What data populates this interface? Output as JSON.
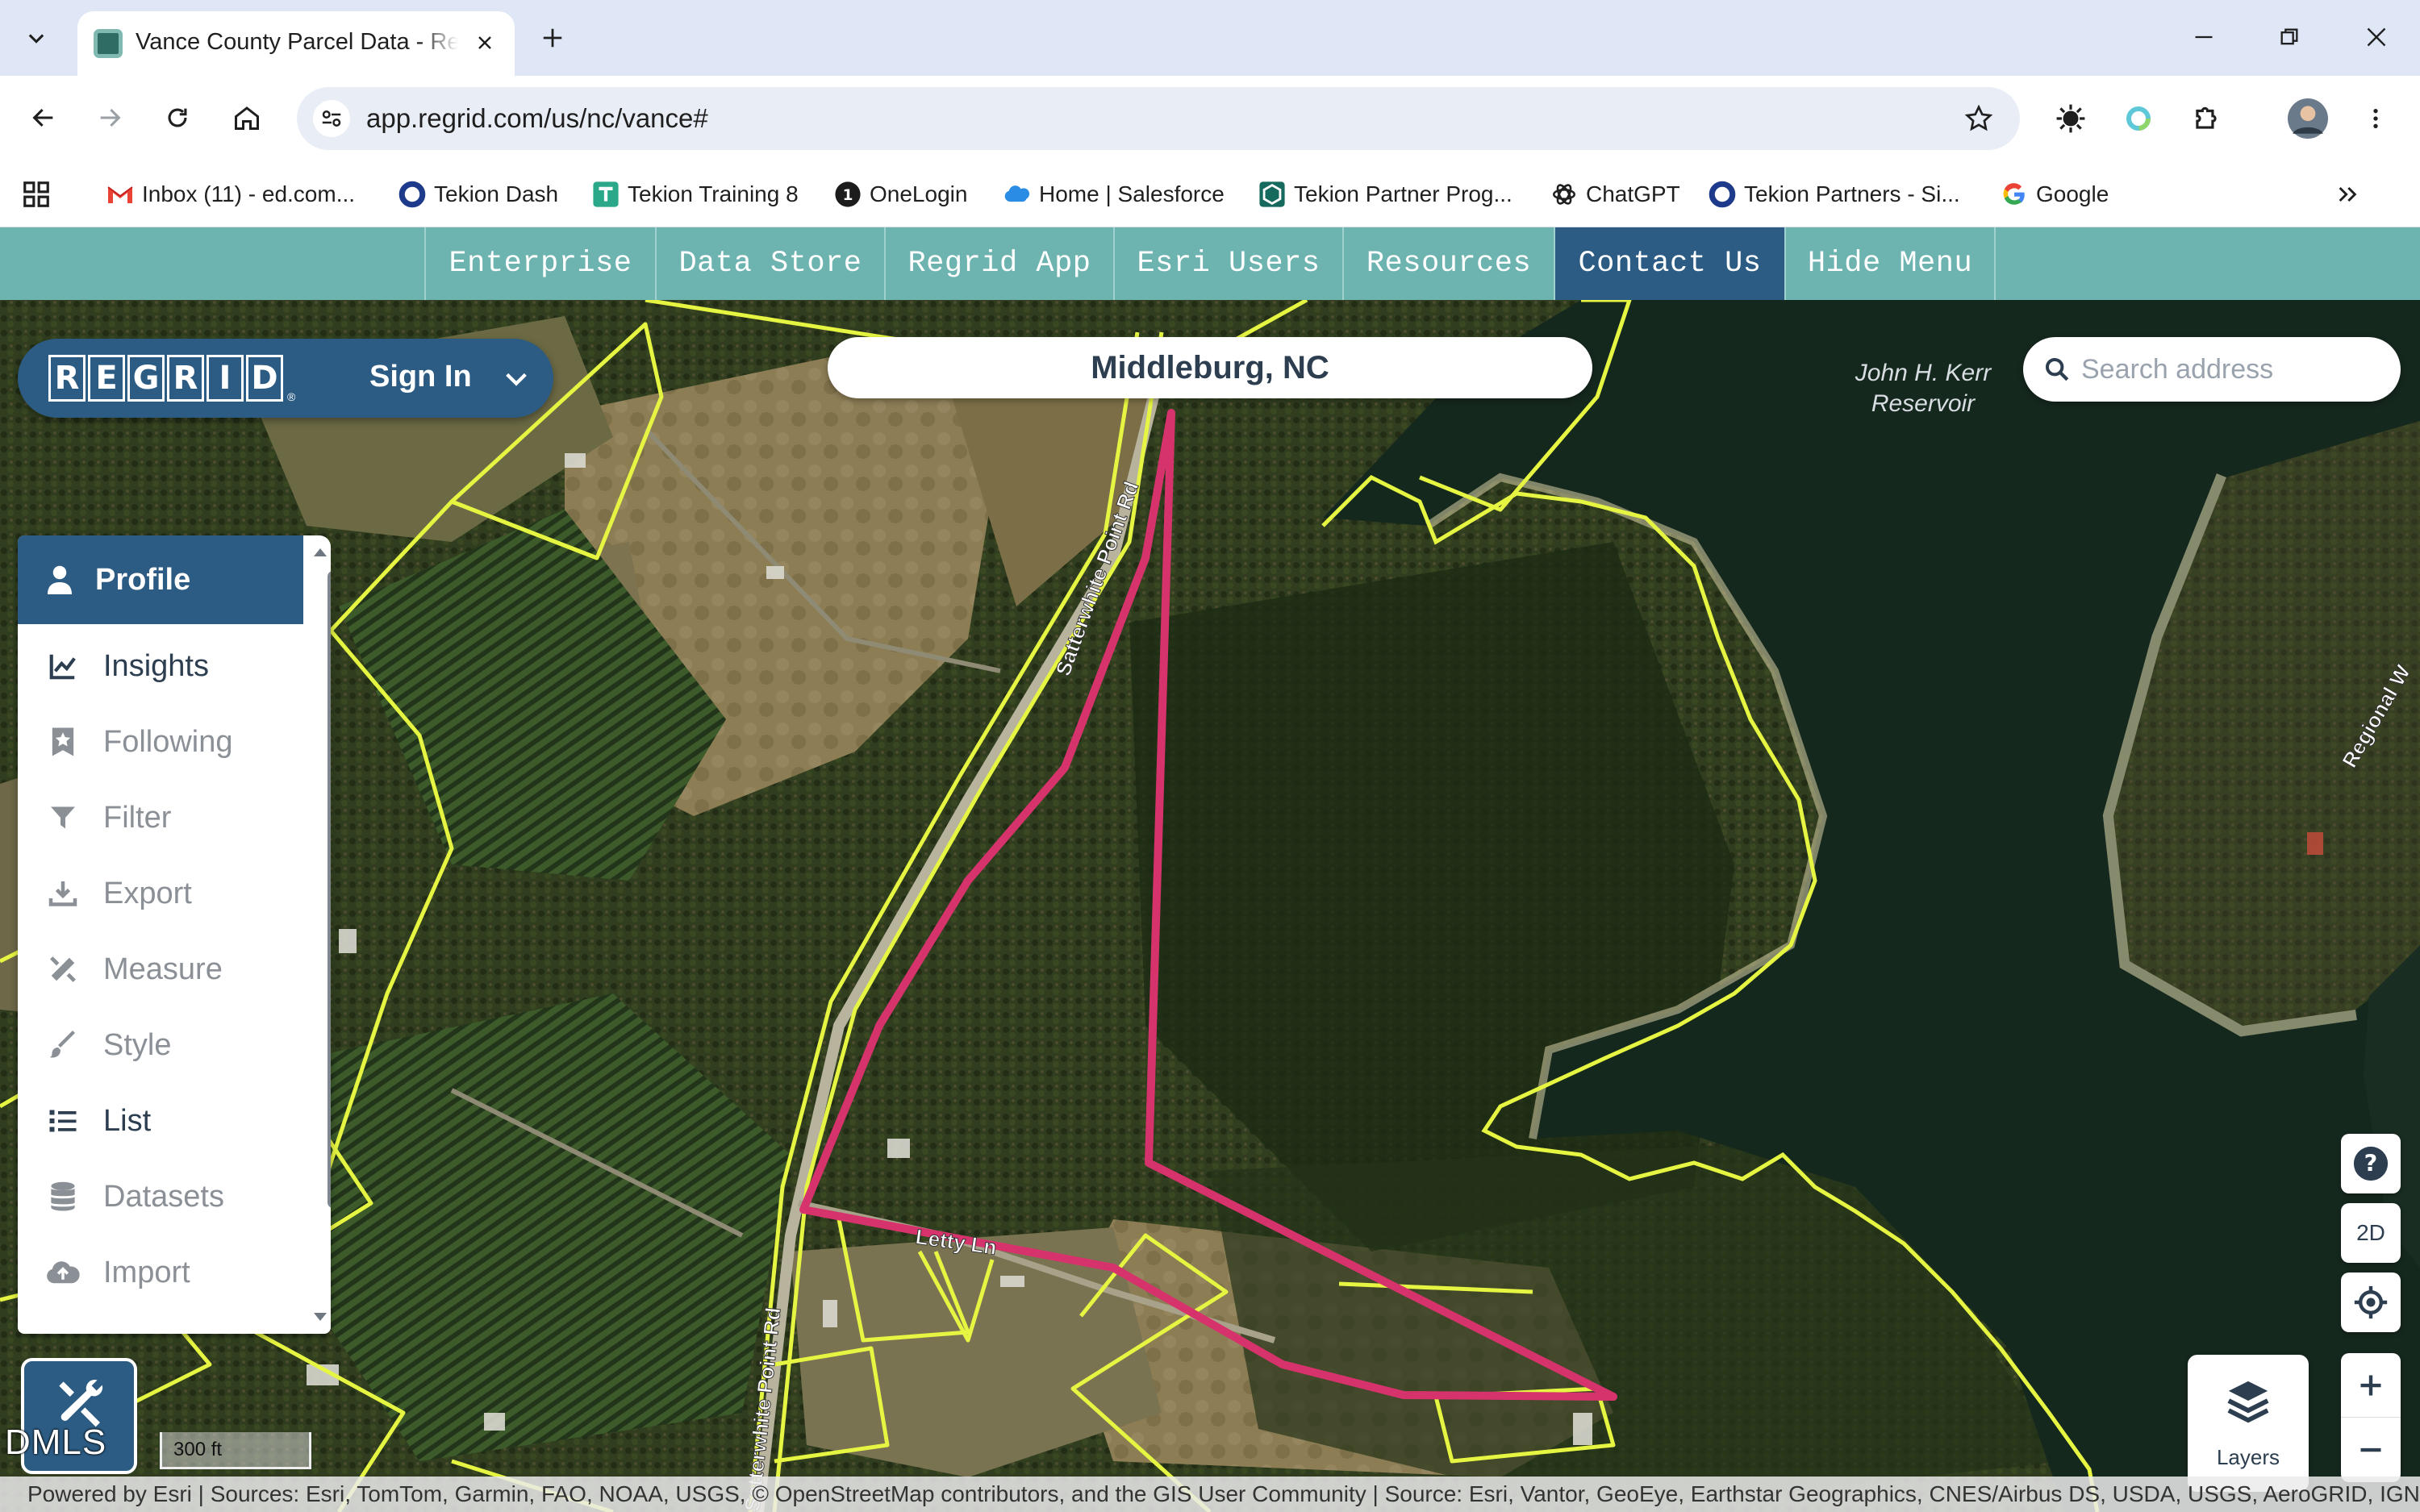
{
  "browser": {
    "tab_title": "Vance County Parcel Data - Regrid",
    "url": "app.regrid.com/us/nc/vance#",
    "bookmarks": [
      {
        "label": "Inbox (11) - ed.com..."
      },
      {
        "label": "Tekion Dash"
      },
      {
        "label": "Tekion Training 8"
      },
      {
        "label": "OneLogin"
      },
      {
        "label": "Home | Salesforce"
      },
      {
        "label": "Tekion Partner Prog..."
      },
      {
        "label": "ChatGPT"
      },
      {
        "label": "Tekion Partners - Si..."
      },
      {
        "label": "Google"
      }
    ]
  },
  "top_menu": {
    "items": [
      {
        "label": "Enterprise"
      },
      {
        "label": "Data Store"
      },
      {
        "label": "Regrid App"
      },
      {
        "label": "Esri Users"
      },
      {
        "label": "Resources"
      },
      {
        "label": "Contact Us"
      },
      {
        "label": "Hide Menu"
      }
    ],
    "active": "Contact Us"
  },
  "header": {
    "logo_letters": [
      "R",
      "E",
      "G",
      "R",
      "I",
      "D"
    ],
    "logo_reg": "®",
    "sign_in": "Sign In",
    "location": "Middleburg, NC",
    "search_placeholder": "Search address"
  },
  "sidebar": {
    "items": [
      {
        "label": "Profile",
        "icon": "person-icon"
      },
      {
        "label": "Insights",
        "icon": "chart-line-icon"
      },
      {
        "label": "Following",
        "icon": "star-icon"
      },
      {
        "label": "Filter",
        "icon": "filter-icon"
      },
      {
        "label": "Export",
        "icon": "download-icon"
      },
      {
        "label": "Measure",
        "icon": "ruler-pencil-icon"
      },
      {
        "label": "Style",
        "icon": "brush-icon"
      },
      {
        "label": "List",
        "icon": "list-icon"
      },
      {
        "label": "Datasets",
        "icon": "database-icon"
      },
      {
        "label": "Import",
        "icon": "cloud-upload-icon"
      }
    ]
  },
  "map": {
    "reservoir_label": "John H. Kerr\nReservoir",
    "road_labels": [
      "Satterwhite Point Rd",
      "Satterwhite Point Rd",
      "Letty Ln",
      "Regional W"
    ],
    "scale": "300 ft",
    "watermark": "DMLS",
    "controls": {
      "help": "?",
      "mode": "2D",
      "zoom_in": "+",
      "zoom_out": "−",
      "layers": "Layers"
    },
    "attribution": "Powered by Esri | Sources: Esri, TomTom, Garmin, FAO, NOAA, USGS, © OpenStreetMap contributors, and the GIS User Community | Source: Esri, Vantor, GeoEye, Earthstar Geographics, CNES/Airbus DS, USDA, USGS, AeroGRID, IGN, and the GIS User Community"
  },
  "colors": {
    "menu_bar": "#6db3b0",
    "brand_blue": "#2c5c84",
    "parcel_outline": "#e6f542",
    "selected_parcel": "#d6336c",
    "water": "#15281e"
  }
}
